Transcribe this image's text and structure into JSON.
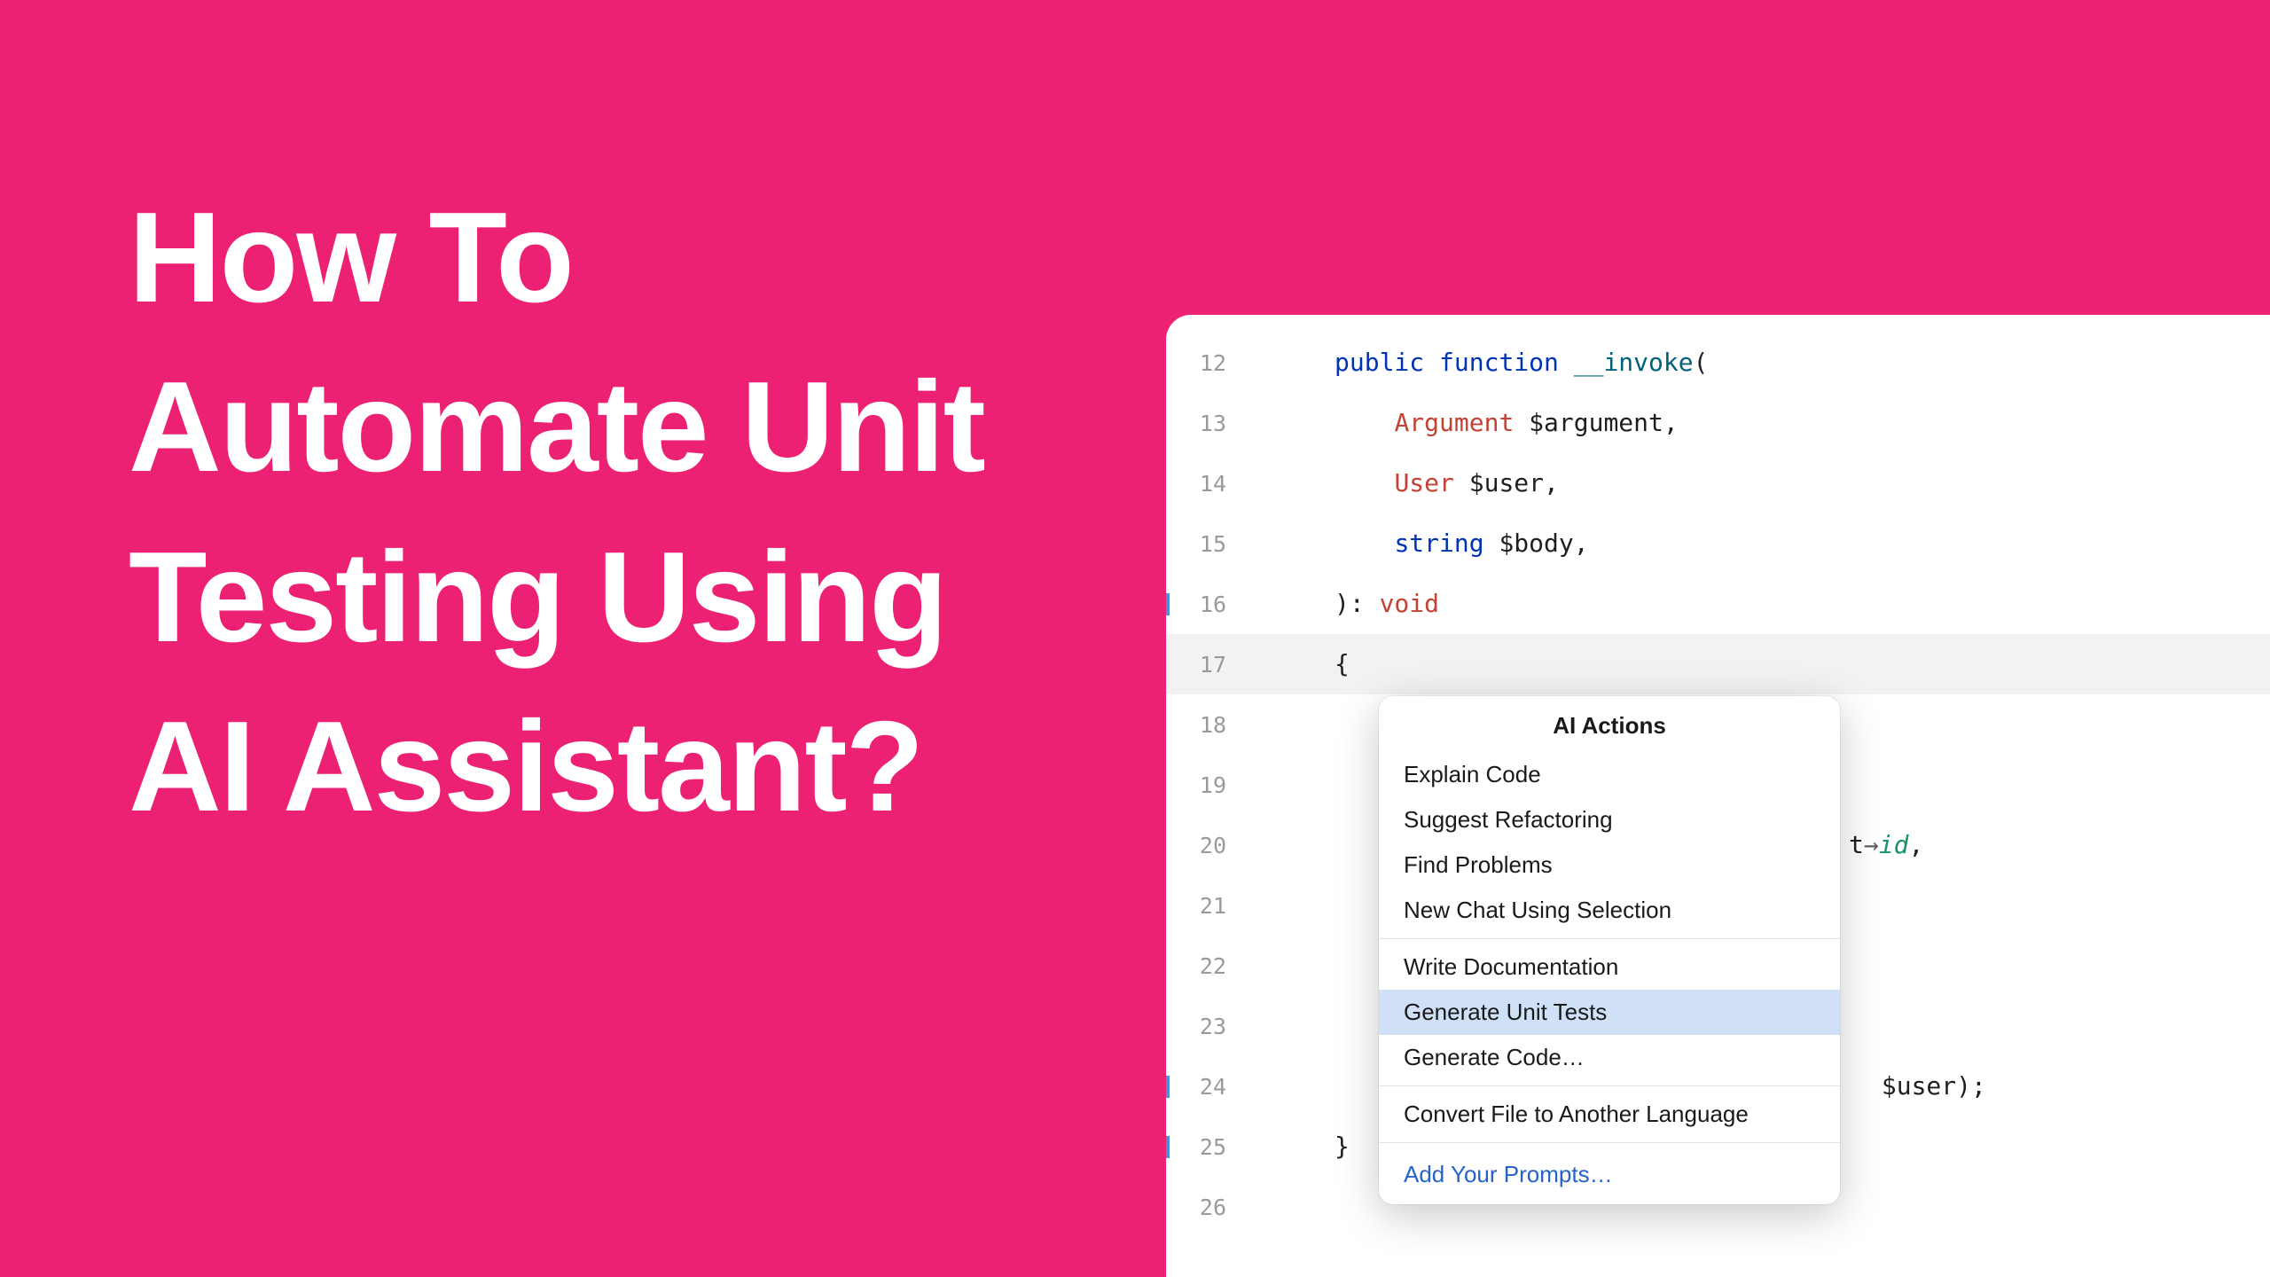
{
  "headline": "How To\nAutomate Unit\nTesting Using\nAI Assistant?",
  "code": {
    "lines": [
      {
        "num": "12",
        "marker": false,
        "highlighted": false,
        "tokens": [
          {
            "t": "public ",
            "c": "tok-keyword"
          },
          {
            "t": "function ",
            "c": "tok-keyword"
          },
          {
            "t": "__invoke",
            "c": "tok-function-def"
          },
          {
            "t": "(",
            "c": "tok-punct"
          }
        ]
      },
      {
        "num": "13",
        "marker": false,
        "highlighted": false,
        "indent": "    ",
        "tokens": [
          {
            "t": "Argument ",
            "c": "tok-type"
          },
          {
            "t": "$argument",
            "c": "tok-var"
          },
          {
            "t": ",",
            "c": "tok-punct"
          }
        ]
      },
      {
        "num": "14",
        "marker": false,
        "highlighted": false,
        "indent": "    ",
        "tokens": [
          {
            "t": "User ",
            "c": "tok-type"
          },
          {
            "t": "$user",
            "c": "tok-var"
          },
          {
            "t": ",",
            "c": "tok-punct"
          }
        ]
      },
      {
        "num": "15",
        "marker": false,
        "highlighted": false,
        "indent": "    ",
        "tokens": [
          {
            "t": "string ",
            "c": "tok-keyword"
          },
          {
            "t": "$body",
            "c": "tok-var"
          },
          {
            "t": ",",
            "c": "tok-punct"
          }
        ]
      },
      {
        "num": "16",
        "marker": true,
        "highlighted": false,
        "tokens": [
          {
            "t": "): ",
            "c": "tok-punct"
          },
          {
            "t": "void",
            "c": "tok-type"
          }
        ]
      },
      {
        "num": "17",
        "marker": false,
        "highlighted": true,
        "tokens": [
          {
            "t": "{",
            "c": "tok-punct"
          }
        ]
      },
      {
        "num": "18",
        "marker": false,
        "highlighted": false,
        "tokens": []
      },
      {
        "num": "19",
        "marker": false,
        "highlighted": false,
        "tokens": []
      },
      {
        "num": "20",
        "marker": false,
        "highlighted": false,
        "tail": [
          {
            "t": "t",
            "c": "tok-var"
          },
          {
            "t": "→",
            "c": "tok-arrow"
          },
          {
            "t": "id",
            "c": "tok-prop"
          },
          {
            "t": ",",
            "c": "tok-punct"
          }
        ],
        "tail_offset": "770px"
      },
      {
        "num": "21",
        "marker": false,
        "highlighted": false,
        "tokens": []
      },
      {
        "num": "22",
        "marker": false,
        "highlighted": false,
        "tokens": []
      },
      {
        "num": "23",
        "marker": false,
        "highlighted": false,
        "tokens": []
      },
      {
        "num": "24",
        "marker": true,
        "highlighted": false,
        "tail": [
          {
            "t": " $user",
            "c": "tok-var"
          },
          {
            "t": ");",
            "c": "tok-punct"
          }
        ],
        "tail_offset": "790px"
      },
      {
        "num": "25",
        "marker": true,
        "highlighted": false,
        "tokens": [
          {
            "t": "}",
            "c": "tok-punct"
          }
        ]
      },
      {
        "num": "26",
        "marker": false,
        "highlighted": false,
        "tokens": []
      }
    ]
  },
  "popup": {
    "title": "AI Actions",
    "groups": [
      [
        {
          "label": "Explain Code",
          "selected": false
        },
        {
          "label": "Suggest Refactoring",
          "selected": false
        },
        {
          "label": "Find Problems",
          "selected": false
        },
        {
          "label": "New Chat Using Selection",
          "selected": false
        }
      ],
      [
        {
          "label": "Write Documentation",
          "selected": false
        },
        {
          "label": "Generate Unit Tests",
          "selected": true
        },
        {
          "label": "Generate Code…",
          "selected": false
        }
      ],
      [
        {
          "label": "Convert File to Another Language",
          "selected": false
        }
      ]
    ],
    "footer_link": "Add Your Prompts…"
  }
}
